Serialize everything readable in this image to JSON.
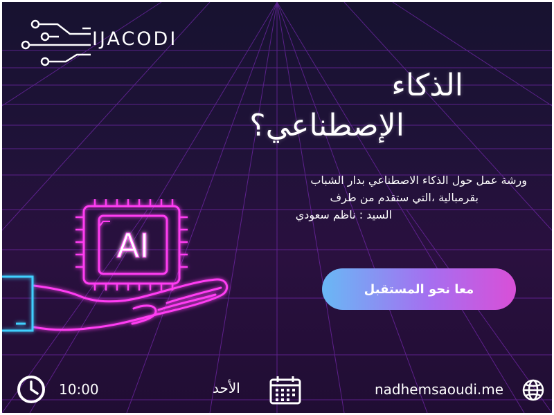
{
  "brand": {
    "name": "IJACODI"
  },
  "headline": {
    "line1": "الذكاء",
    "line2": "الإصطناعي؟"
  },
  "description": {
    "line1": "ورشة عمل حول الذكاء الاصطناعي بدار الشباب",
    "line2": "بقرمبالية ،التي ستقدم من طرف",
    "line3": "السيد : ناظم سعودي"
  },
  "cta": {
    "label": "معا نحو المستقبل"
  },
  "chip": {
    "label": "AI"
  },
  "footer": {
    "time": "10:00",
    "day": "الأحد",
    "website": "nadhemsaoudi.me"
  },
  "colors": {
    "neon_pink": "#ff3cf2",
    "neon_blue": "#3fd0ff",
    "grid": "#8d2fd0",
    "cta_start": "#69b8f5",
    "cta_end": "#d94fd7"
  },
  "icons": [
    "circuit-logo-icon",
    "clock-icon",
    "calendar-icon",
    "globe-icon",
    "ai-chip-icon",
    "hand-icon"
  ]
}
